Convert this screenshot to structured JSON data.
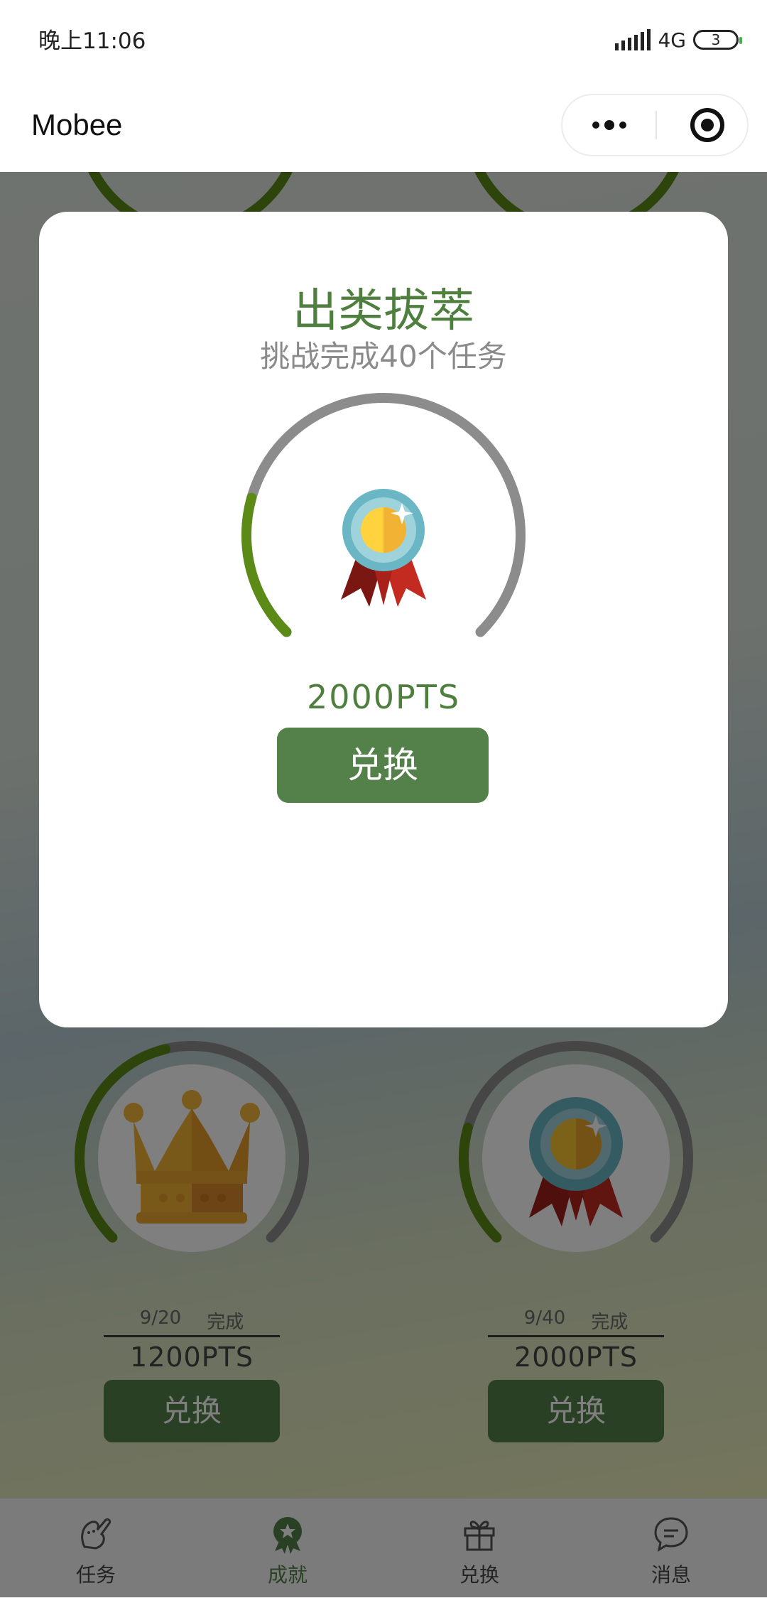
{
  "status_bar": {
    "time": "晚上11:06",
    "network": "4G",
    "battery": "3"
  },
  "header": {
    "title": "Mobee"
  },
  "achievements": [
    {
      "progress": "9/20",
      "status": "完成",
      "points": "1200PTS",
      "button": "兑换",
      "fraction": 0.45
    },
    {
      "progress": "9/40",
      "status": "完成",
      "points": "2000PTS",
      "button": "兑换",
      "fraction": 0.225
    }
  ],
  "modal": {
    "title": "出类拔萃",
    "subtitle": "挑战完成40个任务",
    "points": "2000PTS",
    "button": "兑换",
    "fraction": 0.225
  },
  "tabs": [
    {
      "label": "任务",
      "icon": "task-icon",
      "active": false
    },
    {
      "label": "成就",
      "icon": "achievement-icon",
      "active": true
    },
    {
      "label": "兑换",
      "icon": "gift-icon",
      "active": false
    },
    {
      "label": "消息",
      "icon": "message-icon",
      "active": false
    }
  ],
  "colors": {
    "accent": "#548049",
    "ring_progress": "#5b8a17",
    "ring_track": "#8c8c8c"
  }
}
